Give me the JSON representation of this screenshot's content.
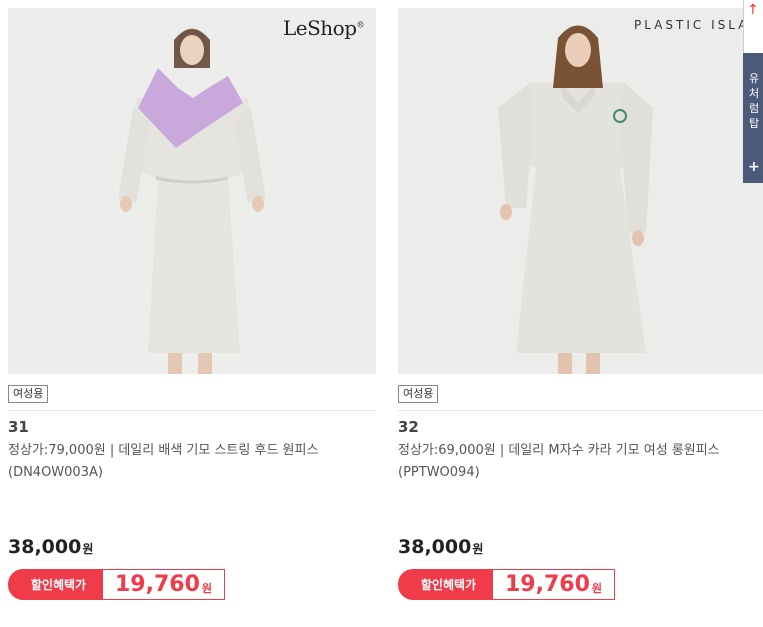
{
  "products": [
    {
      "brand": "LeShop",
      "tag": "여성용",
      "number": "31",
      "name": "정상가:79,000원 | 데일리 배색 기모 스트링 후드 원피스 (DN4OW003A)",
      "price": "38,000",
      "currency": "원",
      "discount_label": "할인혜택가",
      "discount_price": "19,760",
      "colors": {
        "dress": "#e5e4df",
        "hood": "#c9a9dc"
      }
    },
    {
      "brand": "PLASTIC ISLAND",
      "tag": "여성용",
      "number": "32",
      "name": "정상가:69,000원 | 데일리 M자수 카라 기모 여성 롱원피스 (PPTWO094)",
      "price": "38,000",
      "currency": "원",
      "discount_label": "할인혜택가",
      "discount_price": "19,760",
      "colors": {
        "dress": "#e3e2dc"
      }
    }
  ],
  "sidebar": {
    "text": "유처럼탑",
    "plus": "+",
    "top_icon": "↑"
  },
  "accent": "#ef3b4a"
}
